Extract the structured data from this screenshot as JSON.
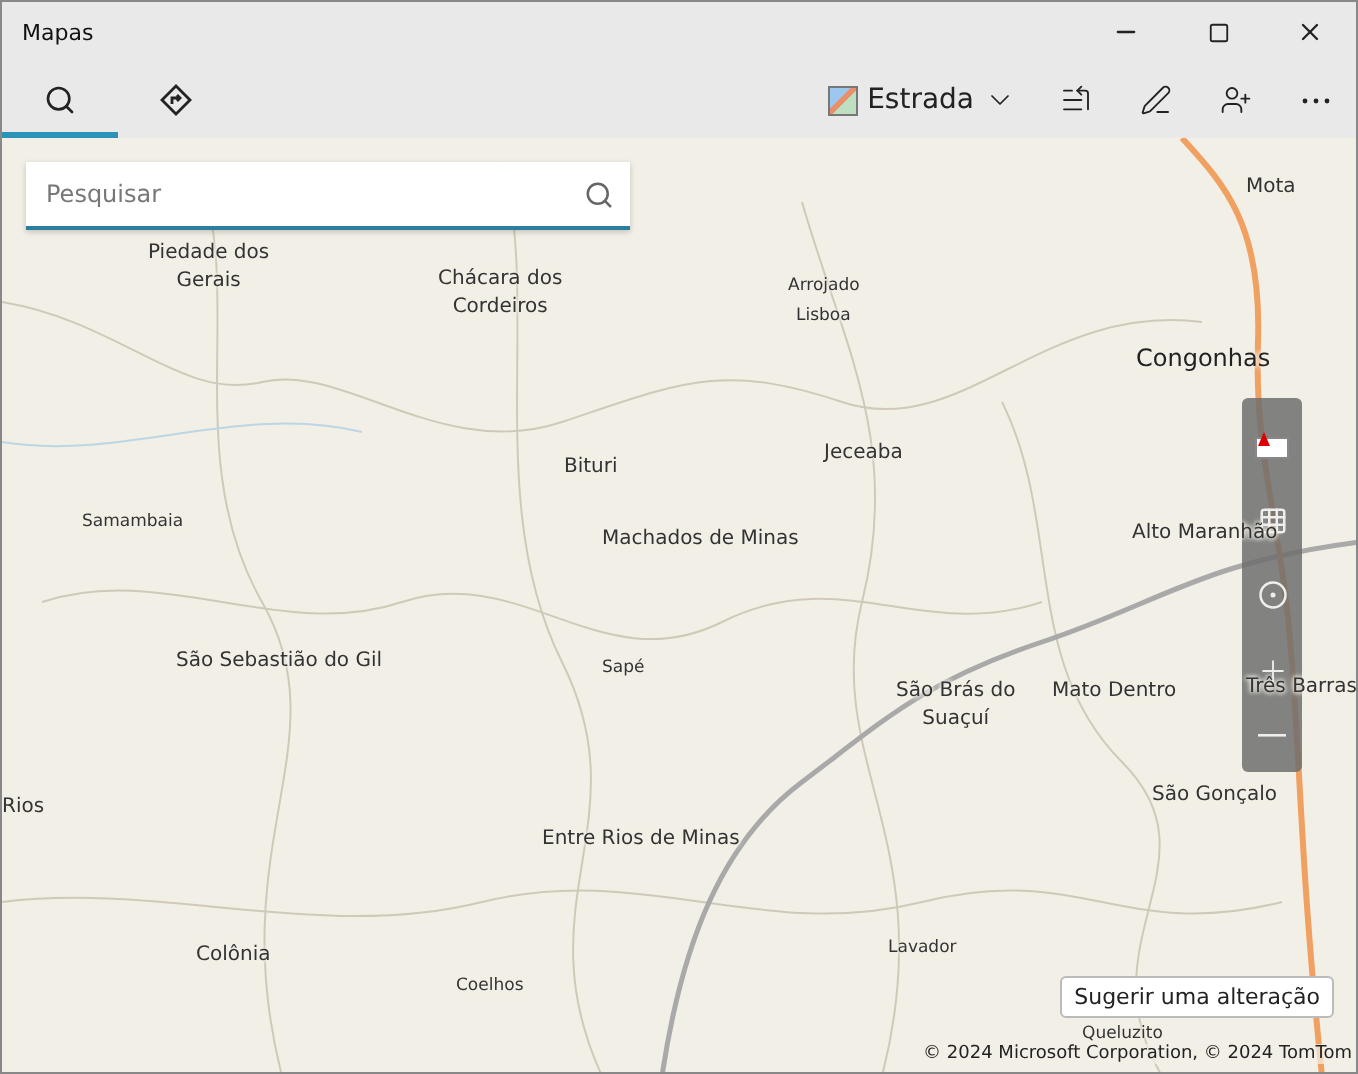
{
  "window": {
    "title": "Mapas"
  },
  "tabs": [
    {
      "kind": "search",
      "selected": true
    },
    {
      "kind": "directions",
      "selected": false
    }
  ],
  "map_style": {
    "label": "Estrada"
  },
  "search": {
    "placeholder": "Pesquisar"
  },
  "places": [
    {
      "name": "Mota",
      "kind": "town"
    },
    {
      "name": "Piedade dos\nGerais",
      "kind": "town"
    },
    {
      "name": "Chácara dos\nCordeiros",
      "kind": "town"
    },
    {
      "name": "Arrojado",
      "kind": "village"
    },
    {
      "name": "Lisboa",
      "kind": "village"
    },
    {
      "name": "Congonhas",
      "kind": "city"
    },
    {
      "name": "Bituri",
      "kind": "town"
    },
    {
      "name": "Jeceaba",
      "kind": "town"
    },
    {
      "name": "Samambaia",
      "kind": "village"
    },
    {
      "name": "Machados de Minas",
      "kind": "town"
    },
    {
      "name": "Alto Maranhão",
      "kind": "town"
    },
    {
      "name": "São Sebastião do Gil",
      "kind": "town"
    },
    {
      "name": "Sapé",
      "kind": "village"
    },
    {
      "name": "São Brás do\nSuaçuí",
      "kind": "town"
    },
    {
      "name": "Mato Dentro",
      "kind": "town"
    },
    {
      "name": "Três Barras",
      "kind": "town"
    },
    {
      "name": "São Gonçalo",
      "kind": "town"
    },
    {
      "name": "Rios",
      "kind": "town"
    },
    {
      "name": "Entre Rios de Minas",
      "kind": "town"
    },
    {
      "name": "Lavador",
      "kind": "village"
    },
    {
      "name": "Colônia",
      "kind": "town"
    },
    {
      "name": "Coelhos",
      "kind": "village"
    },
    {
      "name": "Queluzito",
      "kind": "village"
    }
  ],
  "suggest_button": "Sugerir uma alteração",
  "copyright": "© 2024 Microsoft Corporation, © 2024 TomTom"
}
